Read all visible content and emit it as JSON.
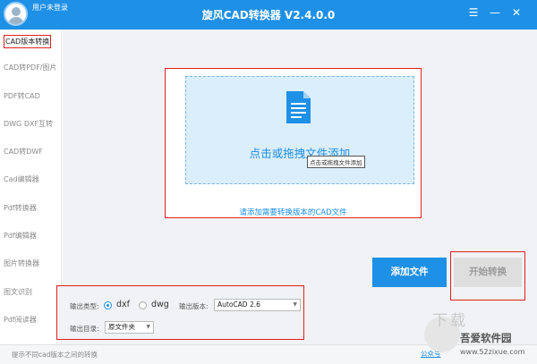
{
  "header": {
    "user_status": "用户未登录",
    "title": "旋风CAD转换器 V2.4.0.0",
    "window_buttons": {
      "menu": "☰",
      "minimize": "—",
      "close": "✕"
    }
  },
  "sidebar": {
    "items": [
      {
        "label": "CAD版本转换",
        "active": true
      },
      {
        "label": "CAD转PDF/图片"
      },
      {
        "label": "PDF转CAD"
      },
      {
        "label": "DWG DXF互转"
      },
      {
        "label": "CAD转DWF"
      },
      {
        "label": "Cad编辑器"
      },
      {
        "label": "Pdf转换器"
      },
      {
        "label": "Pdf编辑器"
      },
      {
        "label": "图片转换器"
      },
      {
        "label": "图文识别"
      },
      {
        "label": "Pdf阅读器"
      }
    ]
  },
  "drop": {
    "text": "点击或拖拽文件添加",
    "tooltip": "点击或拖拽文件添加",
    "hint": "请添加需要转换版本的CAD文件",
    "icon": "document-icon"
  },
  "actions": {
    "add_file": "添加文件",
    "start": "开始转换"
  },
  "options": {
    "output_type_label": "输出类型:",
    "types": [
      {
        "label": "dxf",
        "checked": true
      },
      {
        "label": "dwg",
        "checked": false
      }
    ],
    "version_label": "输出版本:",
    "version_value": "AutoCAD 2.6",
    "dir_label": "输出目录:",
    "dir_value": "原文件夹"
  },
  "status": {
    "text": "提示不同cad版本之间的转换",
    "link": "公众号"
  },
  "watermark": {
    "name": "吾爱软件园",
    "url": "www.52zixue.com",
    "deco": "下载"
  },
  "colors": {
    "accent": "#1e90e6",
    "highlight": "#e02020",
    "drop_bg": "#dbeefb"
  }
}
